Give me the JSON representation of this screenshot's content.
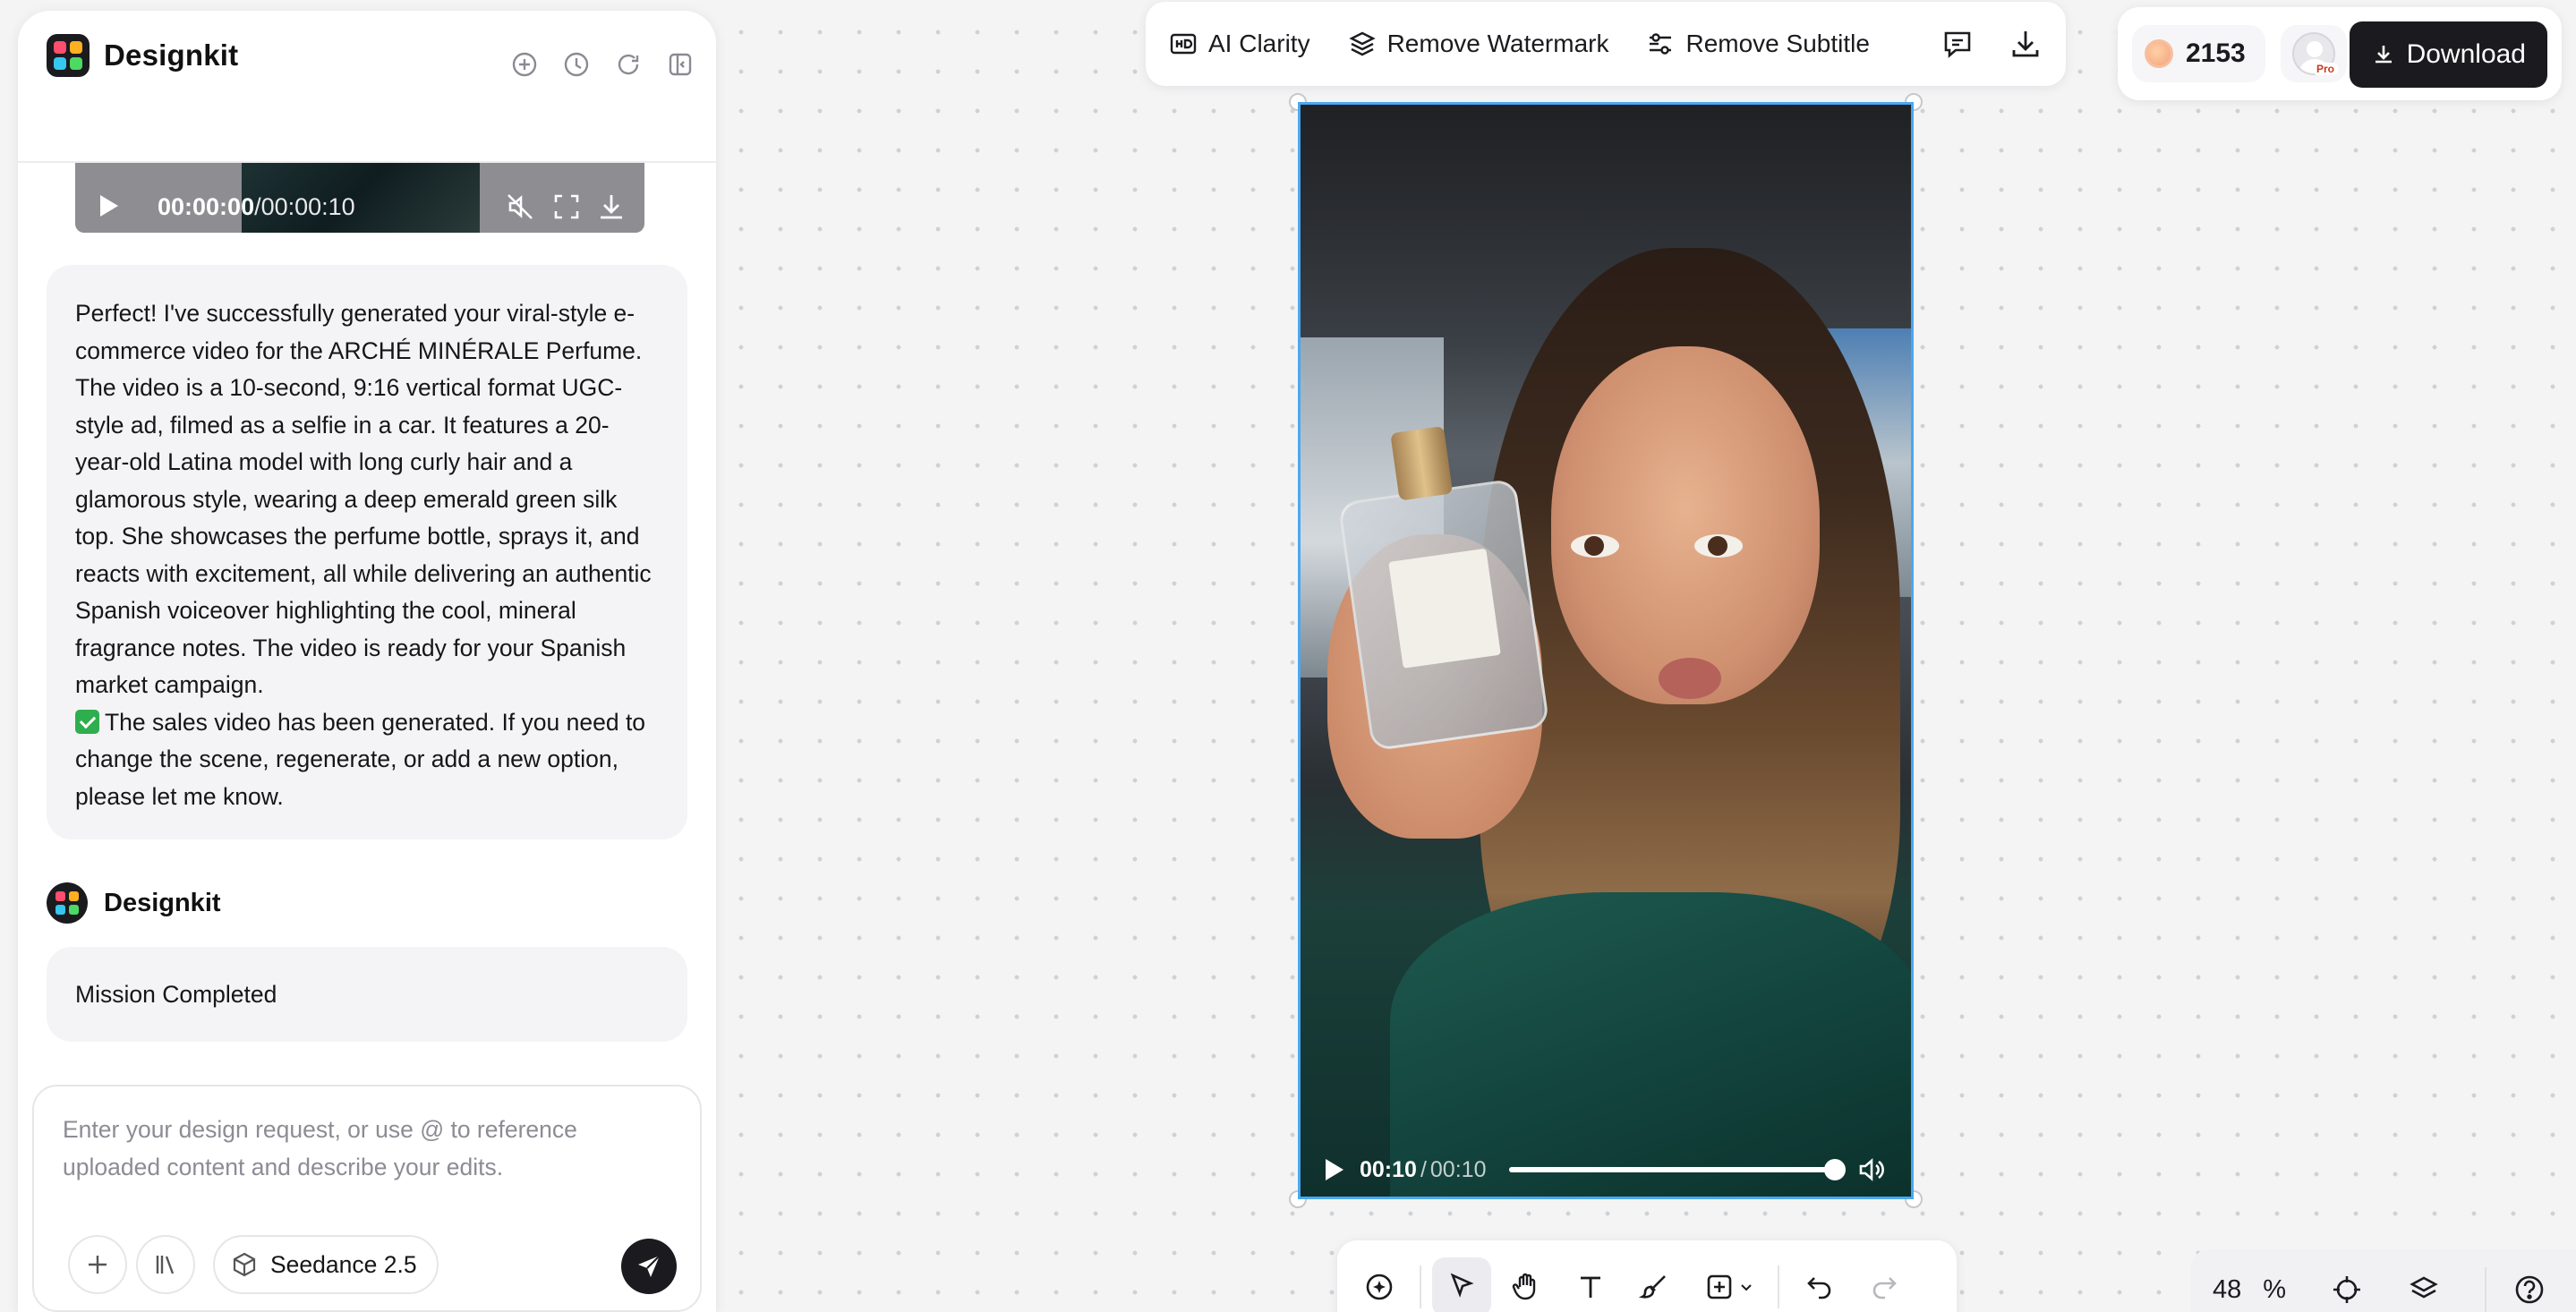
{
  "app": {
    "name": "Designkit"
  },
  "chat": {
    "video_preview": {
      "current_time": "00:00:00",
      "duration": "/00:00:10"
    },
    "message_text": "Perfect! I've successfully generated your viral-style e-commerce video for the ARCHÉ MINÉRALE Perfume. The video is a 10-second, 9:16 vertical format UGC-style ad, filmed as a selfie in a car. It features a 20-year-old Latina model with long curly hair and a glamorous style, wearing a deep emerald green silk top. She showcases the perfume bottle, sprays it, and reacts with excitement, all while delivering an authentic Spanish voiceover highlighting the cool, mineral fragrance notes. The video is ready for your Spanish market campaign.",
    "status_text": "The sales video has been generated. If you need to change the scene, regenerate, or add a new option, please let me know.",
    "sender_name": "Designkit",
    "completion_text": "Mission Completed"
  },
  "composer": {
    "placeholder": "Enter your design request, or use @ to reference uploaded content and describe your edits.",
    "model_label": "Seedance 2.5"
  },
  "toolbar": {
    "ai_clarity": "AI Clarity",
    "remove_watermark": "Remove Watermark",
    "remove_subtitle": "Remove Subtitle"
  },
  "account": {
    "credits": "2153",
    "badge": "Pro",
    "download_label": "Download"
  },
  "player": {
    "current_time": "00:10",
    "separator": "/",
    "duration": "00:10",
    "progress": 1.0
  },
  "canvas": {
    "zoom_value": "48",
    "zoom_unit": "%"
  },
  "colors": {
    "selection": "#4aa8f0",
    "accent_dark": "#1b1b1f",
    "success_check": "#2fae4e"
  }
}
